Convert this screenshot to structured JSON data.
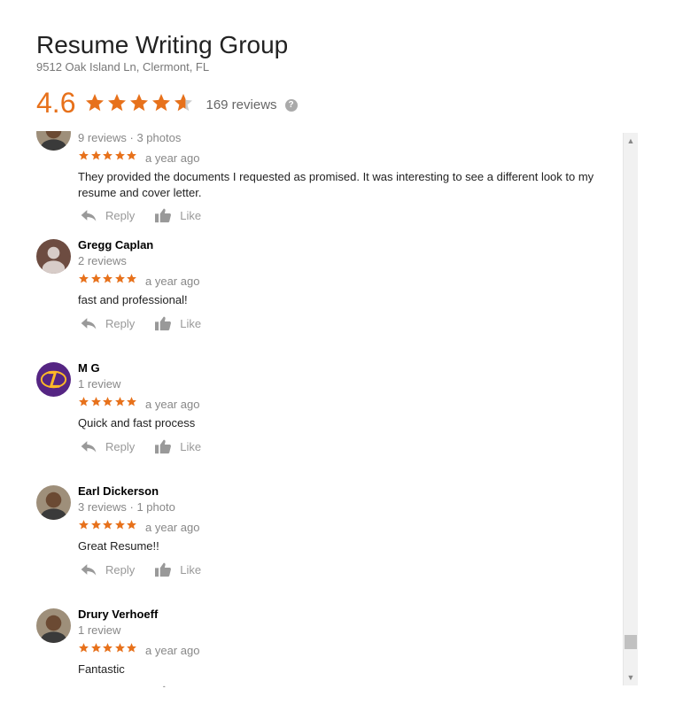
{
  "business": {
    "name": "Resume Writing Group",
    "address": "9512 Oak Island Ln, Clermont, FL",
    "rating": "4.6",
    "rating_value": 4.6,
    "review_count": "169 reviews",
    "help_icon": "?"
  },
  "colors": {
    "star": "#e7711b",
    "star_empty": "#cccccc"
  },
  "labels": {
    "reply": "Reply",
    "like": "Like"
  },
  "reviews": [
    {
      "name": "",
      "meta": "9 reviews · 3 photos",
      "stars": 5,
      "date": "a year ago",
      "text": "They provided the documents I requested  as promised. It was interesting to see a different look to my resume and cover letter.",
      "avatar": "person-photo"
    },
    {
      "name": "Gregg Caplan",
      "meta": "2 reviews",
      "stars": 5,
      "date": "a year ago",
      "text": "fast and professional!",
      "avatar": "default-person"
    },
    {
      "name": "M G",
      "meta": "1 review",
      "stars": 5,
      "date": "a year ago",
      "text": "Quick and fast process",
      "avatar": "lakers-logo"
    },
    {
      "name": "Earl Dickerson",
      "meta": "3 reviews · 1 photo",
      "stars": 5,
      "date": "a year ago",
      "text": "Great Resume!!",
      "avatar": "person-photo"
    },
    {
      "name": "Drury Verhoeff",
      "meta": "1 review",
      "stars": 5,
      "date": "a year ago",
      "text": "Fantastic",
      "avatar": "person-photo"
    }
  ]
}
